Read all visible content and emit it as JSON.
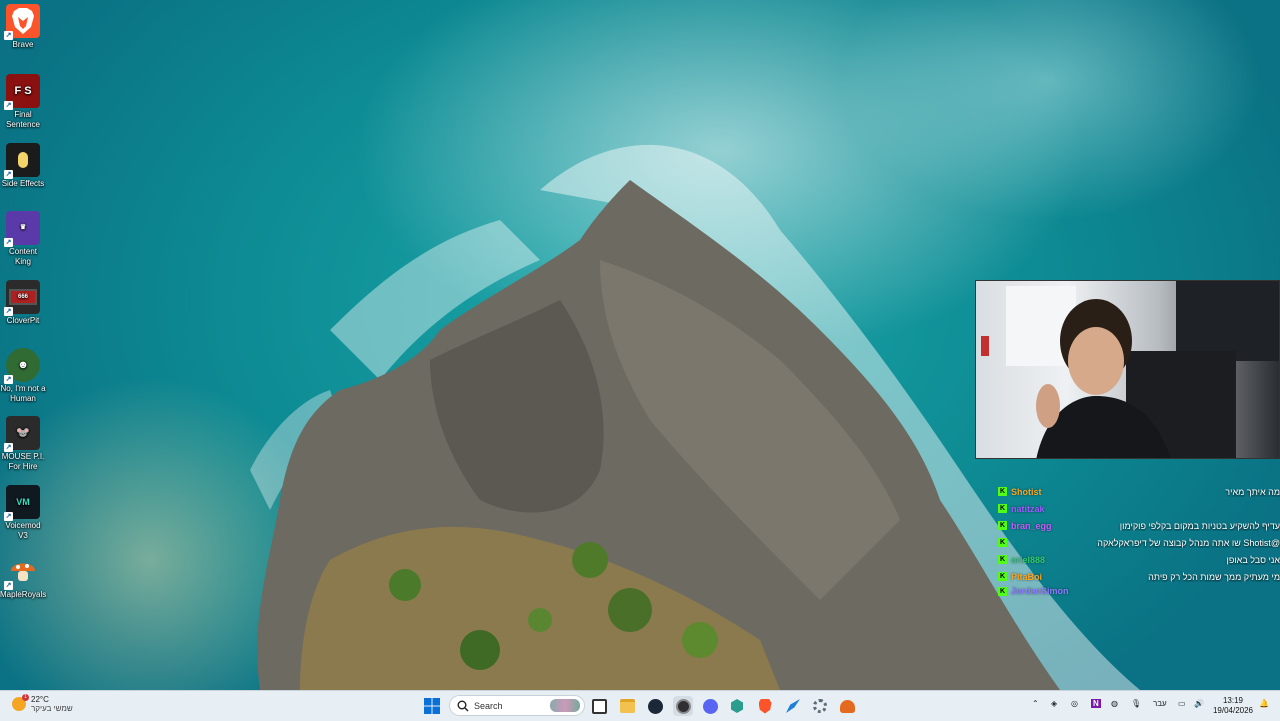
{
  "desktop": {
    "icons": [
      {
        "label": "Brave",
        "icon": "brave-lion-icon",
        "color": "#fb542b"
      },
      {
        "label": "Final Sentence",
        "icon": "final-sentence-icon",
        "color": "#8b1010"
      },
      {
        "label": "Side Effects",
        "icon": "side-effects-icon",
        "color": "#1b1b1b"
      },
      {
        "label": "Content King",
        "icon": "content-king-icon",
        "color": "#5a3aa8"
      },
      {
        "label": "CloverPit",
        "icon": "cloverpit-icon",
        "color": "#2b2b2b"
      },
      {
        "label": "No, I'm not a Human",
        "icon": "no-im-not-a-human-icon",
        "color": "#2f6b32"
      },
      {
        "label": "MOUSE P.I. For Hire",
        "icon": "mouse-pi-icon",
        "color": "#2b2b2b"
      },
      {
        "label": "Voicemod V3",
        "icon": "voicemod-icon",
        "color": "#101820"
      },
      {
        "label": "MapleRoyals",
        "icon": "mushroom-icon",
        "color": "#e36a1e"
      }
    ]
  },
  "overlay": {
    "chat": [
      {
        "user": "Shotist",
        "color": "#f5a524",
        "message": "מה איתך מאיר"
      },
      {
        "user": "natitzak",
        "color": "#9b59ff",
        "message": ""
      },
      {
        "user": "bran_egg",
        "color": "#c45bff",
        "message": "עדיף להשקיע בטניות במקום בקלפי פוקימון"
      },
      {
        "user": "",
        "color": "#7ac4ff",
        "message": "@Shotist שו אתה מנהל קבוצה של דיפראקלאקה"
      },
      {
        "user": "oriel888",
        "color": "#2ecc71",
        "message": "אני סבל באופן"
      },
      {
        "user": "PitaBoi",
        "color": "#f5a524",
        "message": "מי מעתיק ממך שמות הכל רק פיתה"
      },
      {
        "user": "JordanSimon",
        "color": "#8e7bff",
        "message": ""
      }
    ]
  },
  "taskbar": {
    "weather_temp": "22°C",
    "weather_desc": "שמשי בעיקר",
    "search_label": "Search",
    "apps": [
      "windows-start-icon",
      "search-icon",
      "task-view-icon",
      "file-explorer-icon",
      "steam-icon",
      "obs-icon",
      "discord-icon",
      "kick-icon",
      "brave-icon",
      "feather-icon",
      "settings-icon",
      "maple-icon"
    ],
    "lang": "עבר",
    "time": "13:19",
    "date": "19/04/2026"
  },
  "colors": {
    "taskbar_bg": "#e6eef4",
    "kick_green": "#53fc18"
  }
}
